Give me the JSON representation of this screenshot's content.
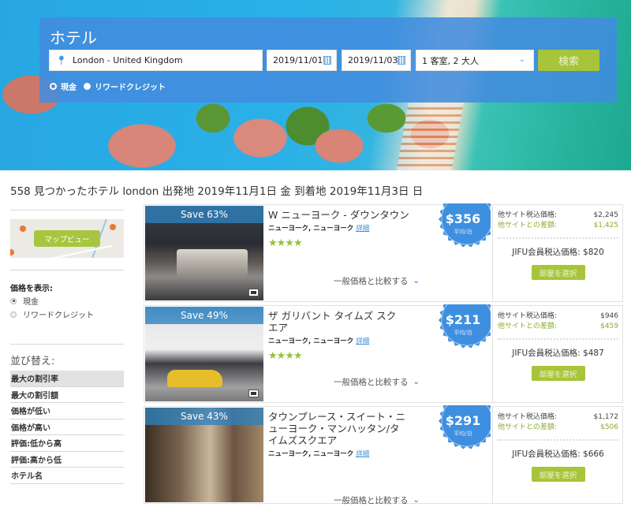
{
  "search": {
    "title": "ホテル",
    "location_value": "London - United Kingdom",
    "checkin_value": "2019/11/01",
    "checkout_value": "2019/11/03",
    "guests_value": "1 客室, 2 大人",
    "search_button": "検索",
    "payment_options": [
      "現金",
      "リワードクレジット"
    ]
  },
  "results": {
    "summary": "558 見つかったホテル london 出発地 2019年11月1日 金 到着地 2019年11月3日 日"
  },
  "sidebar": {
    "map_button": "マップビュー",
    "price_display_label": "価格を表示:",
    "price_options": [
      {
        "label": "現金",
        "selected": true
      },
      {
        "label": "リワードクレジット",
        "selected": false
      }
    ],
    "sort_title": "並び替え:",
    "sort_options": [
      {
        "label": "最大の割引率",
        "active": true
      },
      {
        "label": "最大の割引額",
        "active": false
      },
      {
        "label": "価格が低い",
        "active": false
      },
      {
        "label": "価格が高い",
        "active": false
      },
      {
        "label": "評価:低から高",
        "active": false
      },
      {
        "label": "評価:高から低",
        "active": false
      },
      {
        "label": "ホテル名",
        "active": false
      }
    ]
  },
  "labels": {
    "detail_link": "詳細",
    "compare": "一般価格と比較する",
    "per_night": "平均/泊",
    "other_site_price": "他サイト税込価格:",
    "difference": "他サイトとの差額:",
    "select_room": "部屋を選択"
  },
  "hotels": [
    {
      "save": "Save 63%",
      "name": "W ニューヨーク - ダウンタウン",
      "location": "ニューヨーク, ニューヨーク",
      "stars": 4,
      "price": "$356",
      "other_site_price": "$2,245",
      "difference": "$1,425",
      "member_price": "JIFU会員税込価格: $820"
    },
    {
      "save": "Save 49%",
      "name": "ザ ガリバント タイムズ スクエア",
      "location": "ニューヨーク, ニューヨーク",
      "stars": 4,
      "price": "$211",
      "other_site_price": "$946",
      "difference": "$459",
      "member_price": "JIFU会員税込価格: $487"
    },
    {
      "save": "Save 43%",
      "name": "タウンプレース・スイート・ニューヨーク・マンハッタン/タイムズスクエア",
      "location": "ニューヨーク, ニューヨーク",
      "stars": 0,
      "price": "$291",
      "other_site_price": "$1,172",
      "difference": "$506",
      "member_price": "JIFU会員税込価格: $666"
    }
  ],
  "colors": {
    "panel_blue": "#428cde",
    "accent_green": "#a8c43a",
    "badge_blue": "#3f8fe0",
    "link_blue": "#3a8fd8"
  }
}
